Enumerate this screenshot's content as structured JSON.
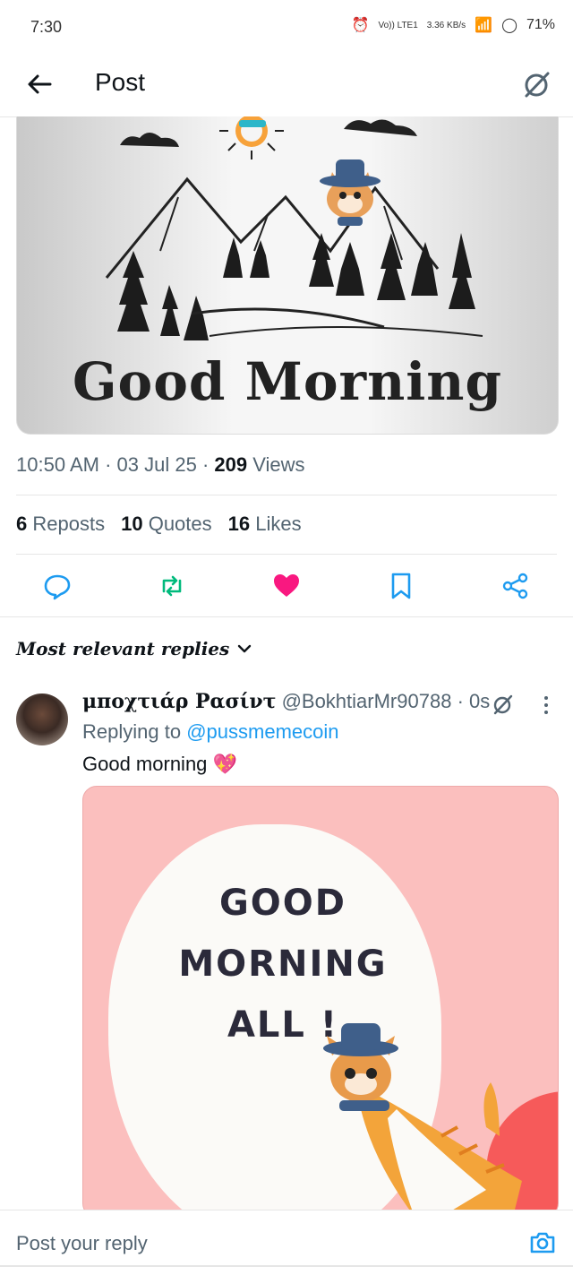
{
  "status_bar": {
    "time": "7:30",
    "network_label": "Vo)) LTE1",
    "speed": "3.36 KB/s",
    "battery": "71%"
  },
  "header": {
    "title": "Post"
  },
  "post": {
    "image_text": "Good Morning",
    "time": "10:50 AM",
    "date": "03 Jul 25",
    "views_count": "209",
    "views_label": "Views",
    "reposts_count": "6",
    "reposts_label": "Reposts",
    "quotes_count": "10",
    "quotes_label": "Quotes",
    "likes_count": "16",
    "likes_label": "Likes"
  },
  "replies": {
    "sort_label": "Most relevant replies",
    "items": [
      {
        "name": "μποχτιάρ Ρασίντ",
        "handle": "@BokhtiarMr90788",
        "time": "0s",
        "replying_prefix": "Replying to",
        "replying_to": "@pussmemecoin",
        "text": "Good morning 💖",
        "image_lines": [
          "GOOD",
          "MORNING",
          "ALL !"
        ]
      }
    ]
  },
  "compose": {
    "placeholder": "Post your reply"
  },
  "colors": {
    "accent": "#1d9bf0",
    "like": "#f91880",
    "repost": "#00ba7c"
  }
}
